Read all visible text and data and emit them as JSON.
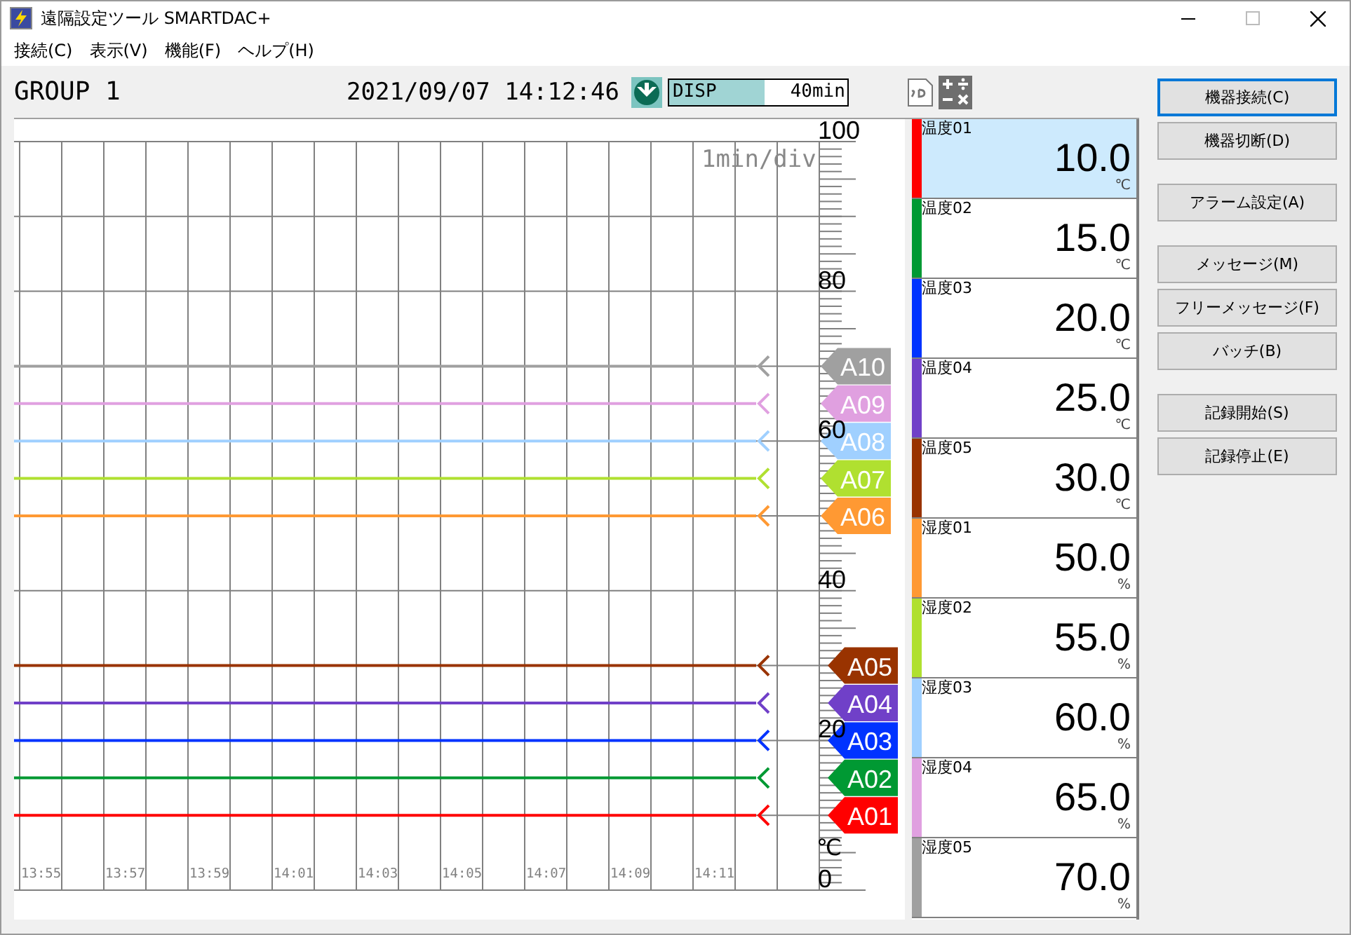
{
  "window": {
    "title": "遠隔設定ツール SMARTDAC+"
  },
  "menu": [
    "接続(C)",
    "表示(V)",
    "機能(F)",
    "ヘルプ(H)"
  ],
  "header": {
    "group": "GROUP 1",
    "datetime": "2021/09/07 14:12:46",
    "disp_label": "DISP",
    "disp_span": "40min"
  },
  "trend": {
    "time_div": "1min/div",
    "unit": "℃",
    "chart_data": {
      "type": "line",
      "ylim": [
        0,
        100
      ],
      "grid": true,
      "categories": [
        "13:55",
        null,
        "13:57",
        null,
        "13:59",
        null,
        "14:01",
        null,
        "14:03",
        null,
        "14:05",
        null,
        "14:07",
        null,
        "14:09",
        null,
        "14:11",
        null
      ],
      "yticks": [
        0,
        20,
        40,
        60,
        80,
        100
      ],
      "series": [
        {
          "name": "A01",
          "color": "#ff0000",
          "values": [
            10,
            10,
            10,
            10,
            10,
            10,
            10,
            10,
            10,
            10,
            10,
            10,
            10,
            10,
            10,
            10,
            10,
            10
          ]
        },
        {
          "name": "A02",
          "color": "#009933",
          "values": [
            15,
            15,
            15,
            15,
            15,
            15,
            15,
            15,
            15,
            15,
            15,
            15,
            15,
            15,
            15,
            15,
            15,
            15
          ]
        },
        {
          "name": "A03",
          "color": "#0033ff",
          "values": [
            20,
            20,
            20,
            20,
            20,
            20,
            20,
            20,
            20,
            20,
            20,
            20,
            20,
            20,
            20,
            20,
            20,
            20
          ]
        },
        {
          "name": "A04",
          "color": "#7040c8",
          "values": [
            25,
            25,
            25,
            25,
            25,
            25,
            25,
            25,
            25,
            25,
            25,
            25,
            25,
            25,
            25,
            25,
            25,
            25
          ]
        },
        {
          "name": "A05",
          "color": "#993300",
          "values": [
            30,
            30,
            30,
            30,
            30,
            30,
            30,
            30,
            30,
            30,
            30,
            30,
            30,
            30,
            30,
            30,
            30,
            30
          ]
        },
        {
          "name": "A06",
          "color": "#ff9933",
          "values": [
            50,
            50,
            50,
            50,
            50,
            50,
            50,
            50,
            50,
            50,
            50,
            50,
            50,
            50,
            50,
            50,
            50,
            50
          ]
        },
        {
          "name": "A07",
          "color": "#b0e030",
          "values": [
            55,
            55,
            55,
            55,
            55,
            55,
            55,
            55,
            55,
            55,
            55,
            55,
            55,
            55,
            55,
            55,
            55,
            55
          ]
        },
        {
          "name": "A08",
          "color": "#a0d0ff",
          "values": [
            60,
            60,
            60,
            60,
            60,
            60,
            60,
            60,
            60,
            60,
            60,
            60,
            60,
            60,
            60,
            60,
            60,
            60
          ]
        },
        {
          "name": "A09",
          "color": "#e0a0e0",
          "values": [
            65,
            65,
            65,
            65,
            65,
            65,
            65,
            65,
            65,
            65,
            65,
            65,
            65,
            65,
            65,
            65,
            65,
            65
          ]
        },
        {
          "name": "A10",
          "color": "#a0a0a0",
          "values": [
            70,
            70,
            70,
            70,
            70,
            70,
            70,
            70,
            70,
            70,
            70,
            70,
            70,
            70,
            70,
            70,
            70,
            70
          ]
        }
      ]
    }
  },
  "channels": [
    {
      "name": "温度01",
      "value": "10.0",
      "unit": "℃",
      "color": "#ff0000",
      "selected": true
    },
    {
      "name": "温度02",
      "value": "15.0",
      "unit": "℃",
      "color": "#009933",
      "selected": false
    },
    {
      "name": "温度03",
      "value": "20.0",
      "unit": "℃",
      "color": "#0033ff",
      "selected": false
    },
    {
      "name": "温度04",
      "value": "25.0",
      "unit": "℃",
      "color": "#7040c8",
      "selected": false
    },
    {
      "name": "温度05",
      "value": "30.0",
      "unit": "℃",
      "color": "#993300",
      "selected": false
    },
    {
      "name": "湿度01",
      "value": "50.0",
      "unit": "%",
      "color": "#ff9933",
      "selected": false
    },
    {
      "name": "湿度02",
      "value": "55.0",
      "unit": "%",
      "color": "#b0e030",
      "selected": false
    },
    {
      "name": "湿度03",
      "value": "60.0",
      "unit": "%",
      "color": "#a0d0ff",
      "selected": false
    },
    {
      "name": "湿度04",
      "value": "65.0",
      "unit": "%",
      "color": "#e0a0e0",
      "selected": false
    },
    {
      "name": "湿度05",
      "value": "70.0",
      "unit": "%",
      "color": "#a0a0a0",
      "selected": false
    }
  ],
  "button_groups": [
    [
      {
        "label": "機器接続(C)",
        "focused": true
      },
      {
        "label": "機器切断(D)",
        "focused": false
      }
    ],
    [
      {
        "label": "アラーム設定(A)",
        "focused": false
      }
    ],
    [
      {
        "label": "メッセージ(M)",
        "focused": false
      },
      {
        "label": "フリーメッセージ(F)",
        "focused": false
      },
      {
        "label": "バッチ(B)",
        "focused": false
      }
    ],
    [
      {
        "label": "記録開始(S)",
        "focused": false
      },
      {
        "label": "記録停止(E)",
        "focused": false
      }
    ]
  ]
}
